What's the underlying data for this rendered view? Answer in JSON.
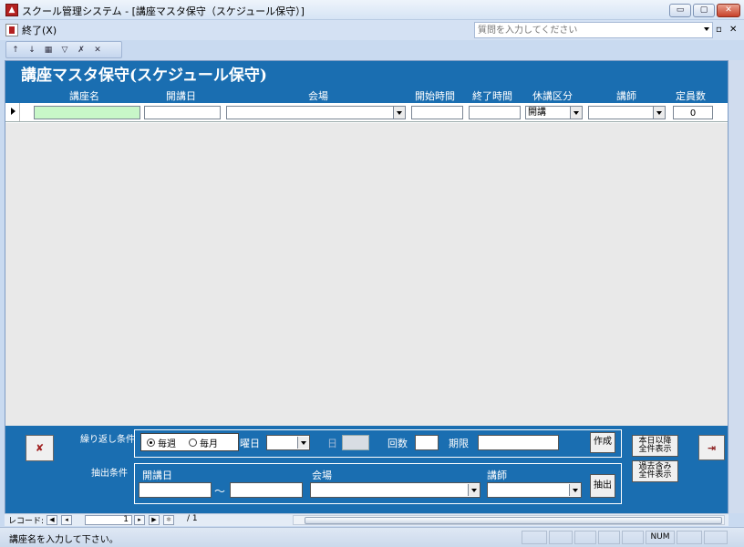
{
  "window": {
    "title": "スクール管理システム - [講座マスタ保守（スケジュール保守）]",
    "min_label": "▭",
    "max_label": "▢",
    "close_label": "✕"
  },
  "menu": {
    "exit_label": "終了(X)",
    "help_placeholder": "質問を入力してください",
    "restore_label": "▫",
    "close_label": "✕"
  },
  "form": {
    "title": "講座マスタ保守(スケジュール保守)",
    "columns": {
      "course_name": "講座名",
      "open_date": "開講日",
      "venue": "会場",
      "start_time": "開始時間",
      "end_time": "終了時間",
      "closure_type": "休講区分",
      "instructor": "講師",
      "capacity": "定員数"
    },
    "row": {
      "course_name": "",
      "open_date": "",
      "venue": "",
      "start_time": "",
      "end_time": "",
      "closure_type": "開講",
      "instructor": "",
      "capacity": "0"
    }
  },
  "footer": {
    "repeat_label": "繰り返し条件",
    "extract_label": "抽出条件",
    "weekly": "毎週",
    "monthly": "毎月",
    "weekday_label": "曜日",
    "day_label": "日",
    "count_label": "回数",
    "deadline_label": "期限",
    "create_button": "作成",
    "ext_open_date": "開講日",
    "ext_venue": "会場",
    "ext_instructor": "講師",
    "tilde": "〜",
    "extract_button": "抽出",
    "today_onward_button": "本日以降\n全件表示",
    "include_past_button": "過去含み\n全件表示"
  },
  "nav": {
    "record_label": "レコード:",
    "current": "1",
    "of_text": "/ 1"
  },
  "status": {
    "message": "講座名を入力して下さい。",
    "num": "NUM"
  },
  "colors": {
    "header_blue": "#1a6eb1",
    "active_cell": "#c8f7c8"
  }
}
